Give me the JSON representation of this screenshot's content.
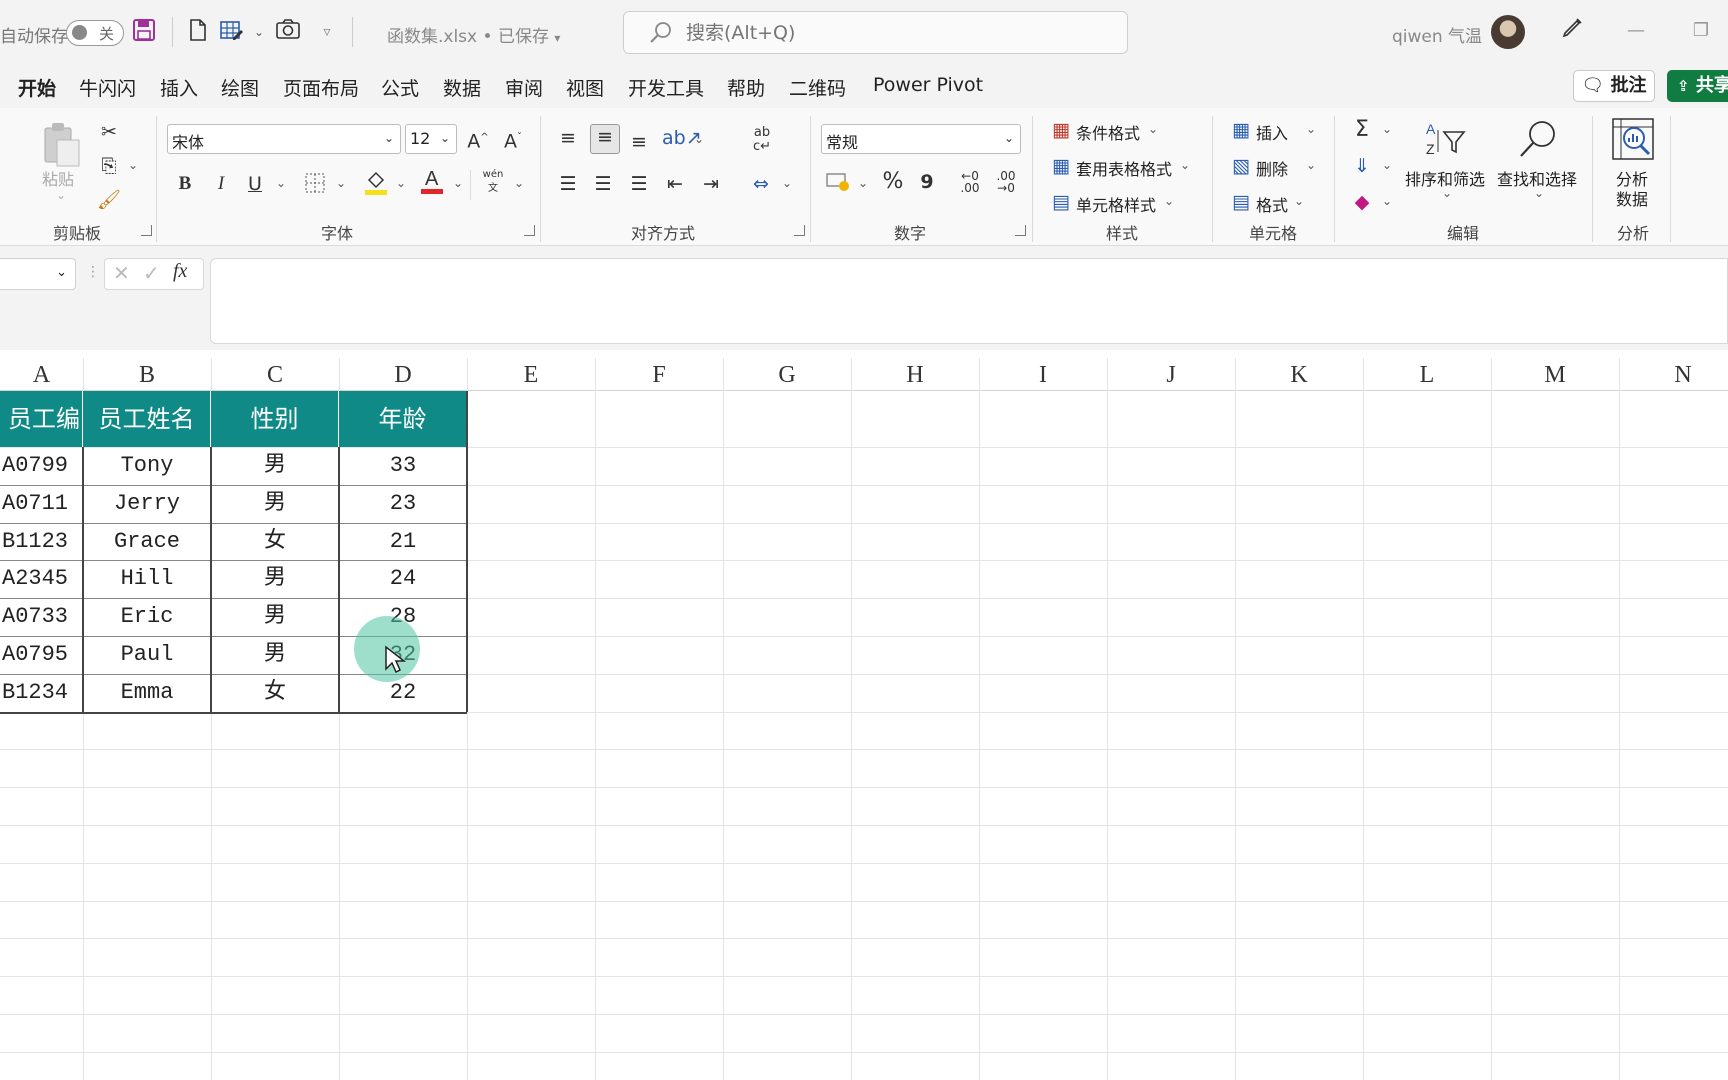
{
  "titlebar": {
    "autosave_label": "自动保存",
    "autosave_state": "关",
    "filename": "函数集.xlsx • 已保存",
    "search_placeholder": "搜索(Alt+Q)",
    "username": "qiwen 气温"
  },
  "tabs": [
    {
      "label": "开始",
      "active": true
    },
    {
      "label": "牛闪闪"
    },
    {
      "label": "插入"
    },
    {
      "label": "绘图"
    },
    {
      "label": "页面布局"
    },
    {
      "label": "公式"
    },
    {
      "label": "数据"
    },
    {
      "label": "审阅"
    },
    {
      "label": "视图"
    },
    {
      "label": "开发工具"
    },
    {
      "label": "帮助"
    },
    {
      "label": "二维码"
    },
    {
      "label": "Power Pivot"
    }
  ],
  "actions": {
    "comment": "批注",
    "share": "共享"
  },
  "ribbon": {
    "clipboard": {
      "label": "剪贴板",
      "paste": "粘贴"
    },
    "font": {
      "label": "字体",
      "name": "宋体",
      "size": "12",
      "bold": "B",
      "italic": "I",
      "underline": "U",
      "phonetic": "wén"
    },
    "alignment": {
      "label": "对齐方式"
    },
    "number": {
      "label": "数字",
      "format": "常规",
      "percent": "%",
      "comma": "9",
      "inc_decimal": ".00",
      "dec_decimal": ".00"
    },
    "styles": {
      "label": "样式",
      "conditional": "条件格式",
      "table_format": "套用表格格式",
      "cell_styles": "单元格样式"
    },
    "cells": {
      "label": "单元格",
      "insert": "插入",
      "delete": "删除",
      "format": "格式"
    },
    "editing": {
      "label": "编辑",
      "sort_filter": "排序和筛选",
      "find_select": "查找和选择"
    },
    "analysis": {
      "label": "分析",
      "analyze_line1": "分析",
      "analyze_line2": "数据"
    }
  },
  "formula_bar": {
    "fx": "fx"
  },
  "columns": [
    "A",
    "B",
    "C",
    "D",
    "E",
    "F",
    "G",
    "H",
    "I",
    "J",
    "K",
    "L",
    "M",
    "N"
  ],
  "table": {
    "headers": [
      "员工编号",
      "员工姓名",
      "性别",
      "年龄"
    ],
    "rows": [
      [
        "A0799",
        "Tony",
        "男",
        "33"
      ],
      [
        "A0711",
        "Jerry",
        "男",
        "23"
      ],
      [
        "B1123",
        "Grace",
        "女",
        "21"
      ],
      [
        "A2345",
        "Hill",
        "男",
        "24"
      ],
      [
        "A0733",
        "Eric",
        "男",
        "28"
      ],
      [
        "A0795",
        "Paul",
        "男",
        "32"
      ],
      [
        "B1234",
        "Emma",
        "女",
        "22"
      ]
    ]
  },
  "colors": {
    "accent": "#107c41",
    "table_header": "#0f8a87",
    "cursor_halo": "#4fc4a0"
  }
}
